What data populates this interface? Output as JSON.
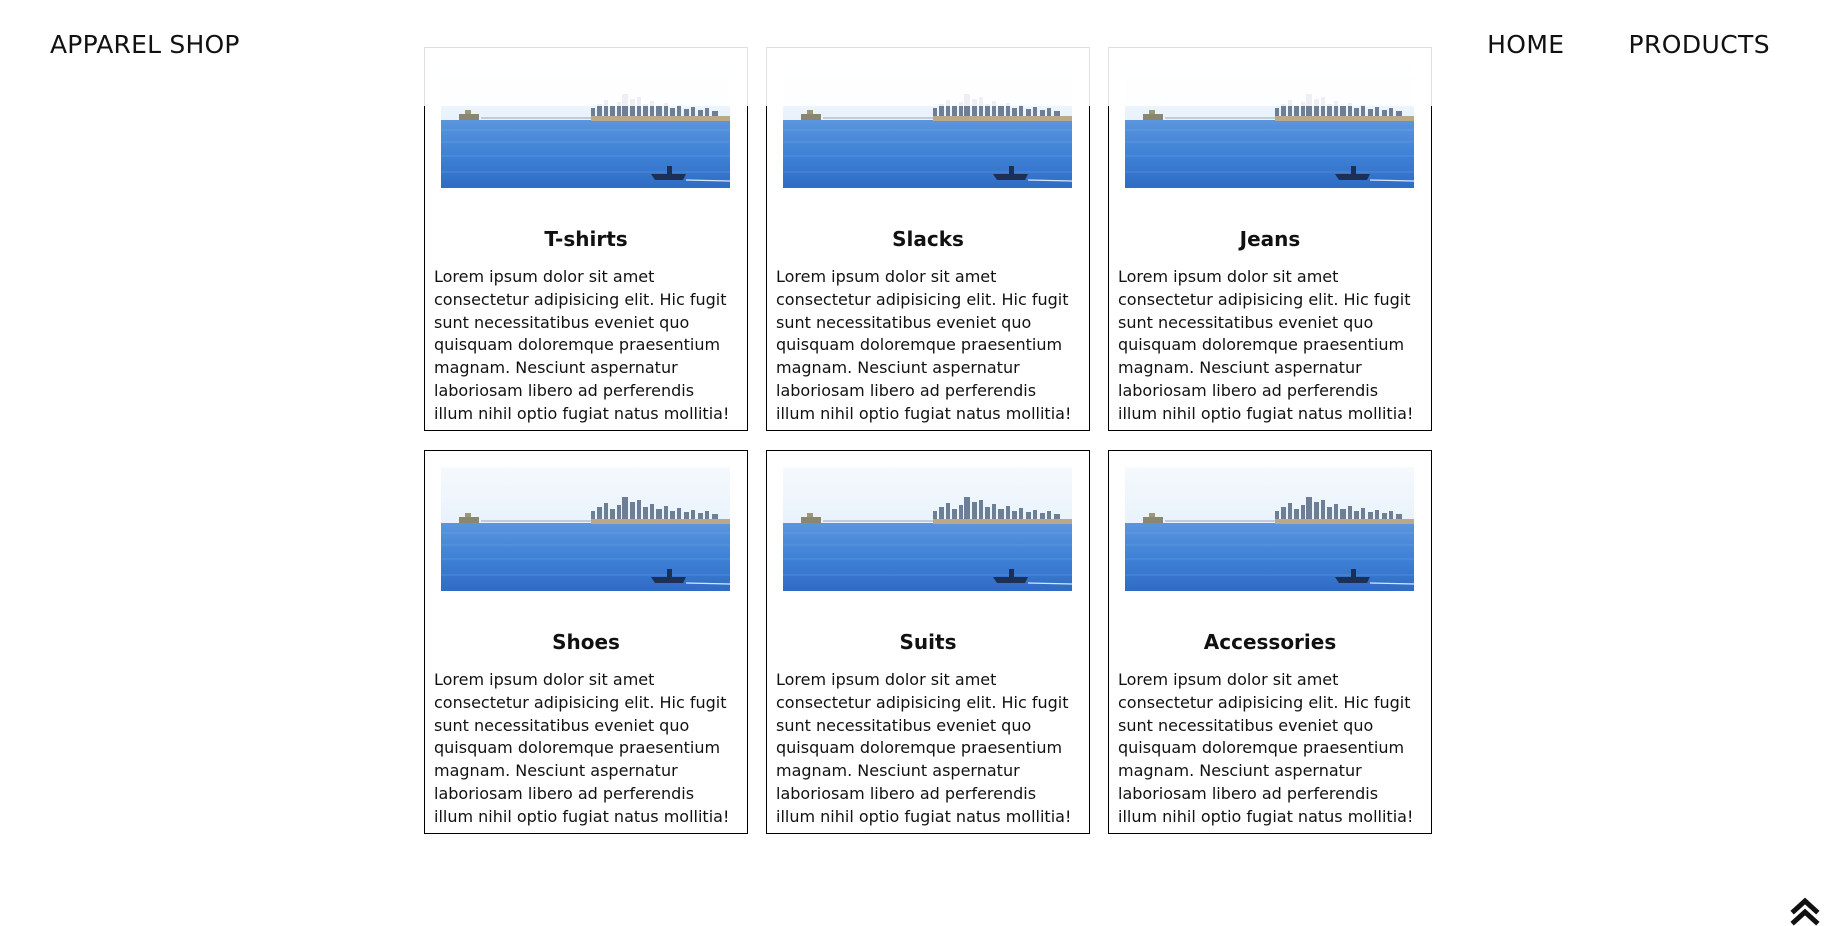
{
  "header": {
    "logo": "APPAREL SHOP",
    "nav": [
      "HOME",
      "PRODUCTS"
    ]
  },
  "products": [
    {
      "title": "T-shirts",
      "description": "Lorem ipsum dolor sit amet consectetur adipisicing elit. Hic fugit sunt necessitatibus eveniet quo quisquam doloremque praesentium magnam. Nesciunt aspernatur laboriosam libero ad perferendis illum nihil optio fugiat natus mollitia!"
    },
    {
      "title": "Slacks",
      "description": "Lorem ipsum dolor sit amet consectetur adipisicing elit. Hic fugit sunt necessitatibus eveniet quo quisquam doloremque praesentium magnam. Nesciunt aspernatur laboriosam libero ad perferendis illum nihil optio fugiat natus mollitia!"
    },
    {
      "title": "Jeans",
      "description": "Lorem ipsum dolor sit amet consectetur adipisicing elit. Hic fugit sunt necessitatibus eveniet quo quisquam doloremque praesentium magnam. Nesciunt aspernatur laboriosam libero ad perferendis illum nihil optio fugiat natus mollitia!"
    },
    {
      "title": "Shoes",
      "description": "Lorem ipsum dolor sit amet consectetur adipisicing elit. Hic fugit sunt necessitatibus eveniet quo quisquam doloremque praesentium magnam. Nesciunt aspernatur laboriosam libero ad perferendis illum nihil optio fugiat natus mollitia!"
    },
    {
      "title": "Suits",
      "description": "Lorem ipsum dolor sit amet consectetur adipisicing elit. Hic fugit sunt necessitatibus eveniet quo quisquam doloremque praesentium magnam. Nesciunt aspernatur laboriosam libero ad perferendis illum nihil optio fugiat natus mollitia!"
    },
    {
      "title": "Accessories",
      "description": "Lorem ipsum dolor sit amet consectetur adipisicing elit. Hic fugit sunt necessitatibus eveniet quo quisquam doloremque praesentium magnam. Nesciunt aspernatur laboriosam libero ad perferendis illum nihil optio fugiat natus mollitia!"
    }
  ],
  "back_to_top_icon": "double-chevron-up-icon",
  "colors": {
    "water": "#3f82d6",
    "sky": "#e8f2fb"
  }
}
